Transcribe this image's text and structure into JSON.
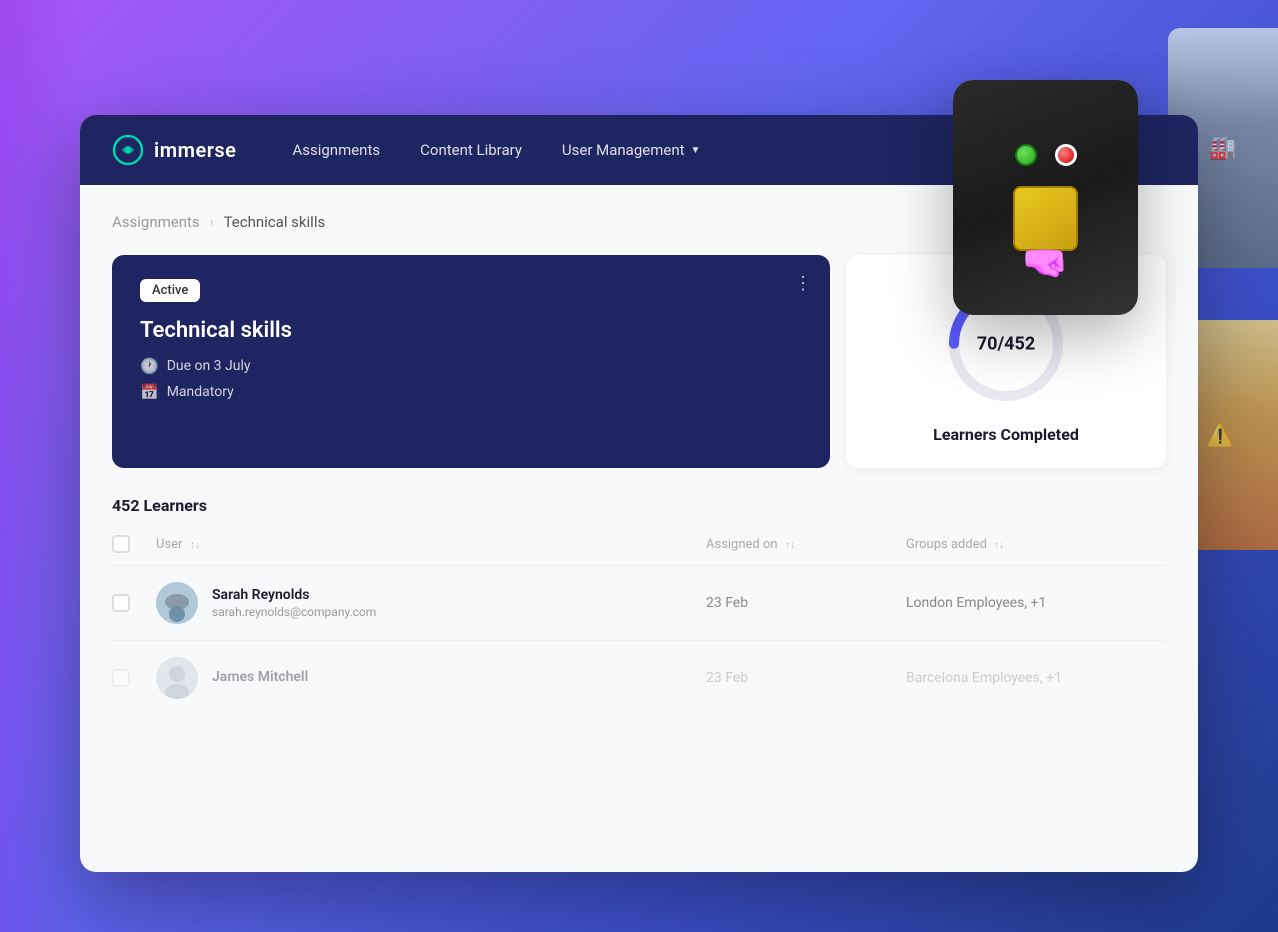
{
  "app": {
    "logo_text": "immerse",
    "logo_icon_label": "immerse-logo-icon"
  },
  "navbar": {
    "links": [
      {
        "id": "assignments",
        "label": "Assignments"
      },
      {
        "id": "content_library",
        "label": "Content Library"
      },
      {
        "id": "user_management",
        "label": "User Management",
        "has_dropdown": true
      }
    ]
  },
  "breadcrumb": {
    "parent": "Assignments",
    "separator": "›",
    "current": "Technical skills"
  },
  "assignment_card": {
    "status_badge": "Active",
    "title": "Technical skills",
    "due_date_icon": "🕐",
    "due_date_label": "Due on 3 July",
    "mandatory_icon": "📅",
    "mandatory_label": "Mandatory",
    "menu_icon": "⋮"
  },
  "stats_card": {
    "completed": 70,
    "total": 452,
    "label": "Learners Completed",
    "donut_value": "70/452",
    "percentage": 15.49
  },
  "learners_section": {
    "count_label": "452 Learners",
    "table": {
      "headers": [
        {
          "id": "user",
          "label": "User"
        },
        {
          "id": "assigned_on",
          "label": "Assigned on"
        },
        {
          "id": "groups_added",
          "label": "Groups added"
        }
      ],
      "rows": [
        {
          "id": "row-sarah",
          "name": "Sarah Reynolds",
          "email": "sarah.reynolds@company.com",
          "assigned_on": "23 Feb",
          "groups": "London Employees, +1",
          "avatar_type": "vr"
        },
        {
          "id": "row-james",
          "name": "James Mitchell",
          "email": "",
          "assigned_on": "23 Feb",
          "groups": "Barcelona Employees, +1",
          "avatar_type": "generic",
          "faded": true
        }
      ]
    }
  }
}
